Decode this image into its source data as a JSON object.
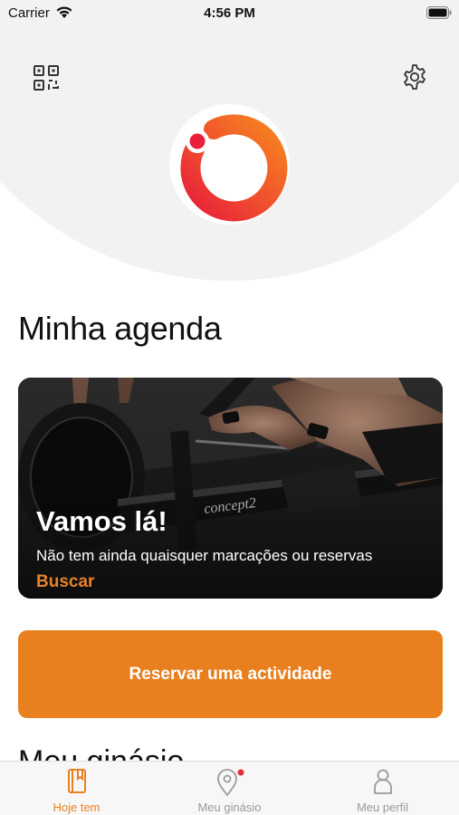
{
  "status_bar": {
    "carrier": "Carrier",
    "time": "4:56 PM"
  },
  "header": {
    "qr_icon": "qr-code-icon",
    "settings_icon": "gear-icon"
  },
  "colors": {
    "accent": "#e8801f",
    "logo_gradient_start": "#e8203a",
    "logo_gradient_end": "#f7851f",
    "notification": "#e0303a"
  },
  "agenda": {
    "title": "Minha agenda",
    "card": {
      "headline": "Vamos lá!",
      "subtitle": "Não tem ainda quaisquer marcações ou reservas",
      "link": "Buscar",
      "photo_text": "concept2"
    },
    "book_button": "Reservar uma actividade"
  },
  "next_section_title": "Meu ginásio",
  "tabs": [
    {
      "label": "Hoje tem",
      "icon": "notebook-icon",
      "active": true
    },
    {
      "label": "Meu ginásio",
      "icon": "location-pin-icon",
      "active": false,
      "has_notification": true
    },
    {
      "label": "Meu perfil",
      "icon": "person-icon",
      "active": false
    }
  ]
}
